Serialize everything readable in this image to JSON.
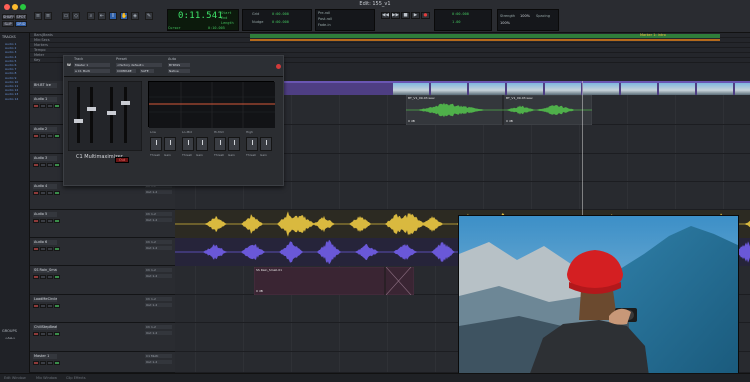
{
  "window": {
    "title": "Edit: 155_v1",
    "traffic_lights": [
      "#ff5f57",
      "#febc2e",
      "#28c840"
    ]
  },
  "toolbar": {
    "modes": [
      "SHUFFLE",
      "SPOT",
      "SLIP",
      "GRID"
    ],
    "counter": "0:11.541",
    "counter_sub": [
      "Start",
      "End",
      "Length"
    ],
    "counter_values": [
      "0:11.541",
      "0:11.541",
      "0:00.000"
    ],
    "nudge_label": "Nudge",
    "grid_label": "Grid",
    "nudge_value": "0:00.000",
    "cursor_label": "Cursor",
    "cursor_value": "0:10.005",
    "transport": [
      "◀◀",
      "▶▶",
      "■",
      "▶",
      "●"
    ],
    "pre_roll": "Pre-roll",
    "post_roll": "Post-roll",
    "fade_in": "Fade-in",
    "counter_right": "0:00.000",
    "sample_rate": "1.00",
    "strength_label": "Strength",
    "spacing_label": "Spacing",
    "strength_value": "100%",
    "spacing_value": "100%"
  },
  "left_panel": {
    "tracks_title": "TRACKS",
    "track_items": [
      "Audio 1",
      "Audio 2",
      "Audio 3",
      "Audio 4",
      "Audio 5",
      "Audio 6",
      "Audio 7",
      "Audio 8",
      "Audio 9",
      "Audio 10",
      "Audio 11",
      "Audio 12",
      "Audio 13",
      "Audio 14"
    ],
    "groups_title": "GROUPS",
    "groups_items": [
      "<ALL>"
    ]
  },
  "rulers": {
    "rows": [
      "Bars|Beats",
      "Min:Secs",
      "Markers",
      "Tempo",
      "Meter",
      "Key"
    ],
    "marker_label": "Marker 1: intro"
  },
  "plugin": {
    "track_label": "Track",
    "preset_label": "Preset",
    "auto_label": "Auto",
    "track_value": "Master 1",
    "preset_value": "<factory default>",
    "insert_value": "a  C1 Multi",
    "compare": "COMPARE",
    "safe": "SAFE",
    "bypass": "BYPASS",
    "native": "Native",
    "name": "C1 Multimaximizer",
    "brand": "W",
    "red_button": "Out",
    "bands": [
      "Low",
      "Lo-Mid",
      "Hi-Mid",
      "High"
    ],
    "controls": [
      "Thresh",
      "Gain",
      "Release",
      "Q"
    ]
  },
  "tracks": [
    {
      "name": "Audio 1",
      "type": "video",
      "insert": "",
      "output": ""
    },
    {
      "name": "Audio 1",
      "type": "audio",
      "insert": "Ch 1-2",
      "output": "Out 1-2"
    },
    {
      "name": "Audio 2",
      "type": "audio",
      "insert": "Ch 1-2",
      "output": "Out 1-2"
    },
    {
      "name": "Audio 3",
      "type": "audio",
      "insert": "Ch 1-2",
      "output": "Out 1-2"
    },
    {
      "name": "Audio 4",
      "type": "audio",
      "insert": "Ch 1-2",
      "output": "Out 1-2"
    },
    {
      "name": "Audio 5",
      "type": "audio",
      "insert": "Ch 1-2",
      "output": "Out 1-2"
    },
    {
      "name": "Audio 6",
      "type": "audio",
      "insert": "Ch 1-2",
      "output": "Out 1-2"
    },
    {
      "name": "SS Rain_Small",
      "type": "audio",
      "insert": "Ch 1-2",
      "output": "Out 1-2"
    },
    {
      "name": "LoadMeCircle2",
      "type": "audio",
      "insert": "Ch 1-2",
      "output": "Out 1-2"
    },
    {
      "name": "ChillStepBeat",
      "type": "audio",
      "insert": "Ch 1-2",
      "output": "Out 1-2"
    },
    {
      "name": "Master 1",
      "type": "master",
      "insert": "C1 Multi",
      "output": "Out 1-2"
    }
  ],
  "clips": {
    "vo_a": "BT_V1_09-03.wav",
    "vo_b": "BT_V1_09-03.wav",
    "rain": "SS Rain_Small-01",
    "gain_label": "0 dB"
  },
  "video_track_name": "BH.BT Ice",
  "bottom": {
    "left": "Edit Window",
    "middle": "Mix Window",
    "right": "Clip Effects"
  },
  "colors": {
    "yellow_wave": "#d9b93f",
    "purple_wave": "#6a58d8",
    "green_wave": "#4fb04a",
    "counter_green": "#3fe36a",
    "accent_blue": "#2e5fa8"
  }
}
